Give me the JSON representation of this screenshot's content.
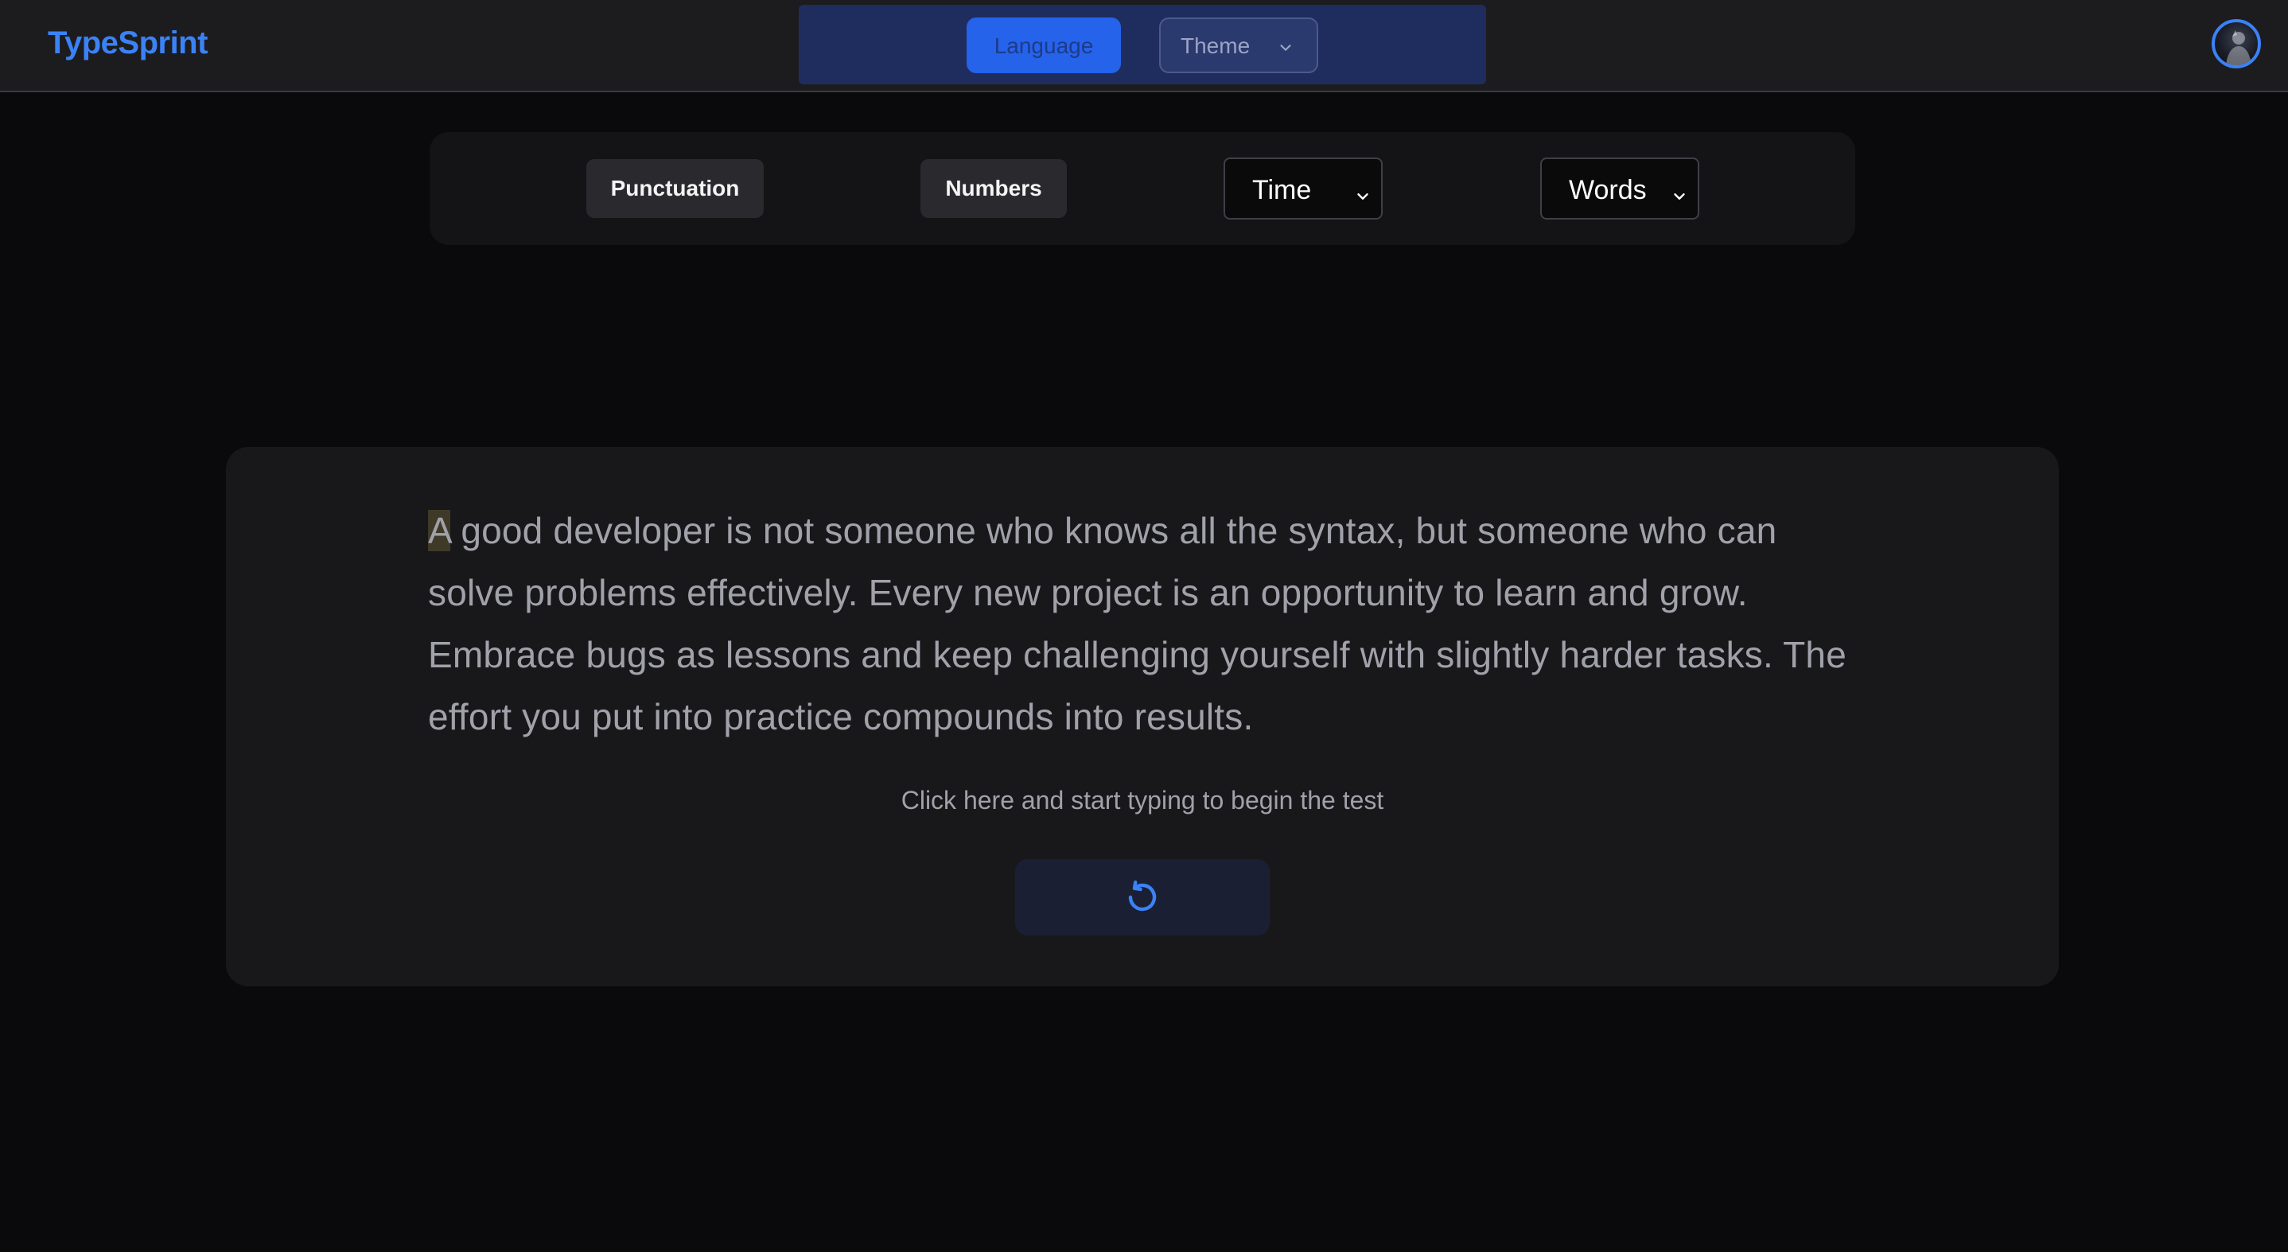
{
  "header": {
    "brand": "TypeSprint",
    "language_label": "Language",
    "theme_label": "Theme"
  },
  "options": {
    "punctuation_label": "Punctuation",
    "numbers_label": "Numbers",
    "time_select": "Time",
    "words_select": "Words"
  },
  "test": {
    "first_char": "A",
    "passage_rest": " good developer is not someone who knows all the syntax, but someone who can solve problems effectively. Every new project is an opportunity to learn and grow. Embrace bugs as lessons and keep challenging yourself with slightly harder tasks. The effort you put into practice compounds into results.",
    "hint": "Click here and start typing to begin the test"
  },
  "icons": {
    "restart": "restart-icon",
    "theme_dropdown": "chevron-down-icon",
    "avatar": "avatar"
  },
  "colors": {
    "accent": "#3b82f6",
    "background": "#0a0a0c",
    "card": "#18181b"
  }
}
